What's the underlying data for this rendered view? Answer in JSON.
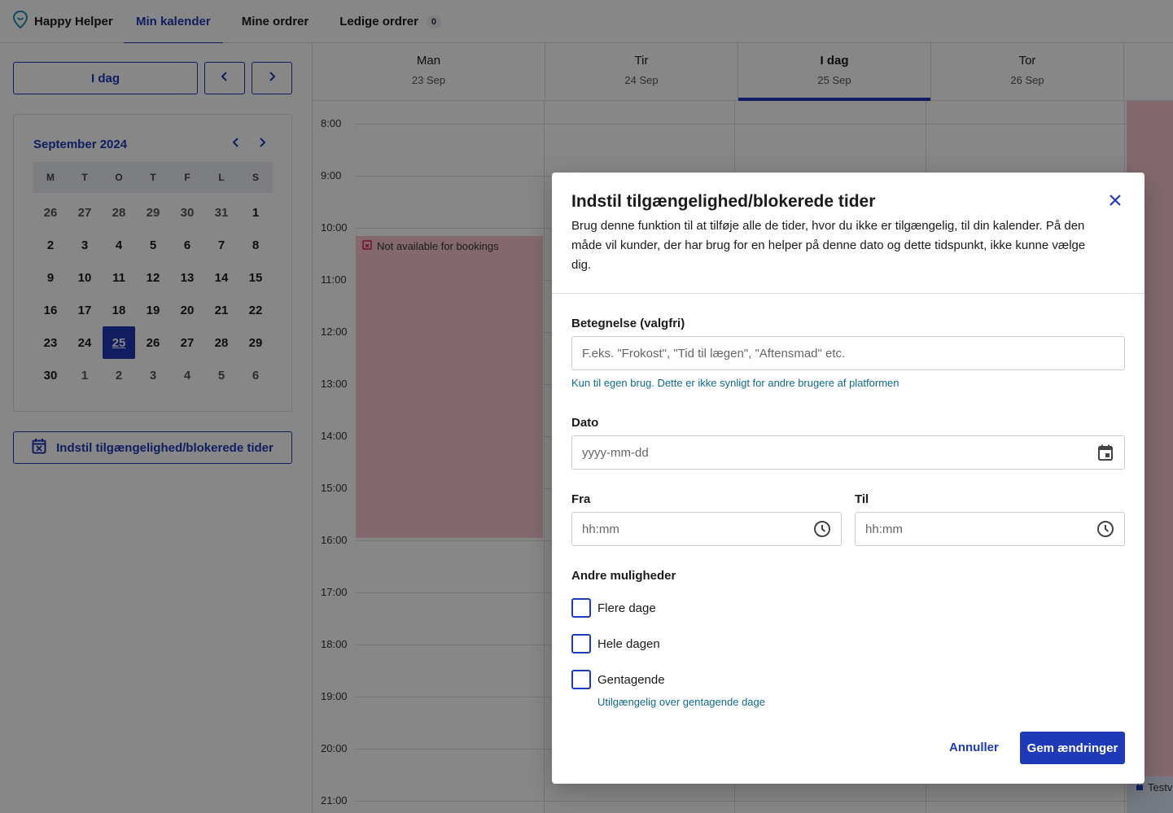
{
  "nav": {
    "brand": "Happy Helper",
    "tabs": [
      {
        "label": "Min kalender"
      },
      {
        "label": "Mine ordrer"
      },
      {
        "label": "Ledige ordrer",
        "count": "0"
      }
    ]
  },
  "sidebar": {
    "today_label": "I dag",
    "calendar": {
      "title": "September 2024",
      "weekdays": [
        "M",
        "T",
        "O",
        "T",
        "F",
        "L",
        "S"
      ],
      "weeks": [
        [
          "26",
          "27",
          "28",
          "29",
          "30",
          "31",
          "1"
        ],
        [
          "2",
          "3",
          "4",
          "5",
          "6",
          "7",
          "8"
        ],
        [
          "9",
          "10",
          "11",
          "12",
          "13",
          "14",
          "15"
        ],
        [
          "16",
          "17",
          "18",
          "19",
          "20",
          "21",
          "22"
        ],
        [
          "23",
          "24",
          "25",
          "26",
          "27",
          "28",
          "29"
        ],
        [
          "30",
          "1",
          "2",
          "3",
          "4",
          "5",
          "6"
        ]
      ],
      "selected": "25"
    },
    "availability_button": "Indstil tilgængelighed/blokerede tider"
  },
  "calendar": {
    "days": [
      {
        "name": "Man",
        "date": "23 Sep"
      },
      {
        "name": "Tir",
        "date": "24 Sep"
      },
      {
        "name": "I dag",
        "date": "25 Sep"
      },
      {
        "name": "Tor",
        "date": "26 Sep"
      }
    ],
    "hours": [
      "8:00",
      "9:00",
      "10:00",
      "11:00",
      "12:00",
      "13:00",
      "14:00",
      "15:00",
      "16:00",
      "17:00",
      "18:00",
      "19:00",
      "20:00",
      "21:00"
    ],
    "block_label": "Not available for bookings",
    "partial_event": "Testv"
  },
  "modal": {
    "title": "Indstil tilgængelighed/blokerede tider",
    "description": "Brug denne funktion til at tilføje alle de tider, hvor du ikke er tilgængelig, til din kalender. På den måde vil kunder, der har brug for en helper på denne dato og dette tidspunkt, ikke kunne vælge dig.",
    "label_field": {
      "label": "Betegnelse (valgfri)",
      "placeholder": "F.eks. \"Frokost\", \"Tid til lægen\", \"Aftensmad\" etc.",
      "value": "",
      "hint": "Kun til egen brug. Dette er ikke synligt for andre brugere af platformen"
    },
    "date_field": {
      "label": "Dato",
      "placeholder": "yyyy-mm-dd",
      "value": ""
    },
    "from_field": {
      "label": "Fra",
      "placeholder": "hh:mm",
      "value": ""
    },
    "to_field": {
      "label": "Til",
      "placeholder": "hh:mm",
      "value": ""
    },
    "options_title": "Andre muligheder",
    "options": [
      {
        "label": "Flere dage",
        "checked": false
      },
      {
        "label": "Hele dagen",
        "checked": false
      },
      {
        "label": "Gentagende",
        "checked": false
      }
    ],
    "repeat_hint": "Utilgængelig over gentagende dage",
    "cancel_label": "Annuller",
    "save_label": "Gem ændringer"
  },
  "colors": {
    "primary": "#1f3ab8",
    "hint": "#0f6a8a",
    "blocked": "#f7c6cf",
    "overlay": "rgba(0,0,0,0.47)"
  }
}
